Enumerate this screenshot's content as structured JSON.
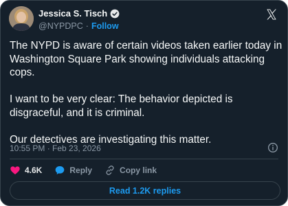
{
  "author": {
    "name": "Jessica S. Tisch",
    "handle": "@NYPDPC",
    "separator": "·",
    "follow_label": "Follow"
  },
  "tweet": {
    "paragraphs": [
      "The NYPD is aware of certain videos taken earlier today in Washington Square Park showing individuals attacking cops.",
      "I want to be very clear: The behavior depicted is disgraceful, and it is criminal.",
      "Our detectives are investigating this matter."
    ],
    "timestamp": "10:55 PM · Feb 23, 2026"
  },
  "actions": {
    "likes": "4.6K",
    "reply_label": "Reply",
    "copy_link_label": "Copy link"
  },
  "read_replies_label": "Read 1.2K replies",
  "colors": {
    "background": "#15202b",
    "accent": "#1d9bf0",
    "like": "#f91880",
    "secondary_text": "#8b98a5"
  },
  "icons": [
    "verified-badge-icon",
    "x-logo-icon",
    "info-icon",
    "heart-icon",
    "reply-icon",
    "link-icon"
  ]
}
